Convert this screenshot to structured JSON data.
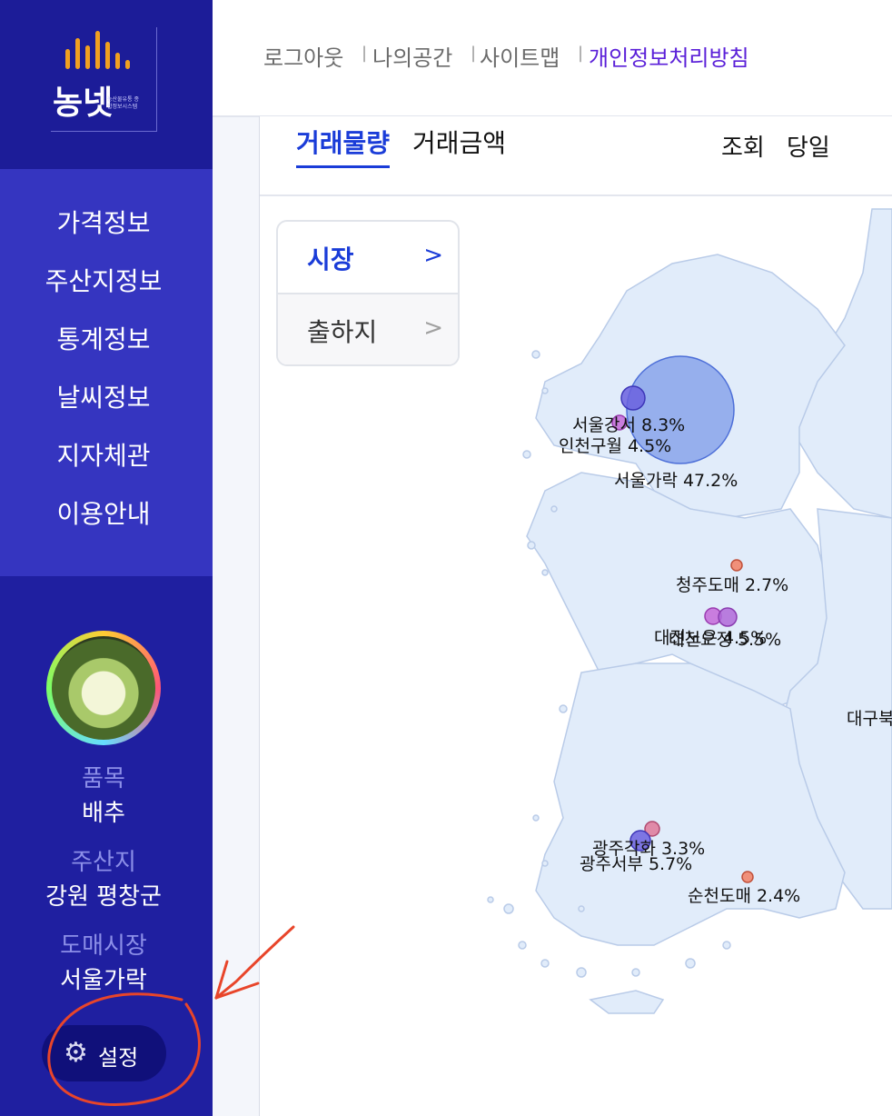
{
  "header": {
    "links": [
      "로그아웃",
      "나의공간",
      "사이트맵",
      "개인정보처리방침"
    ],
    "separator": "|"
  },
  "logo": {
    "brand": "농넷",
    "subtitle": "농산물유통 종합정보시스템"
  },
  "sidebar": {
    "nav": [
      "가격정보",
      "주산지정보",
      "통계정보",
      "날씨정보",
      "지자체관",
      "이용안내"
    ],
    "item_label": "품목",
    "item_value": "배추",
    "origin_label": "주산지",
    "origin_value": "강원 평창군",
    "market_label": "도매시장",
    "market_value": "서울가락",
    "settings_label": "설정",
    "settings_icon": "gear-icon"
  },
  "tabs": {
    "volume": "거래물량",
    "amount": "거래금액"
  },
  "query": {
    "label": "조회",
    "period": "당일"
  },
  "filter": {
    "market": "시장",
    "shipping": "출하지"
  },
  "map": {
    "markets": [
      {
        "name": "서울강서",
        "share": "8.3%",
        "label": "서울강서 8.3%"
      },
      {
        "name": "인천구월",
        "share": "4.5%",
        "label": "인천구월 4.5%"
      },
      {
        "name": "서울가락",
        "share": "47.2%",
        "label": "서울가락 47.2%"
      },
      {
        "name": "청주도매",
        "share": "2.7%",
        "label": "청주도매 2.7%"
      },
      {
        "name": "대전노은",
        "share": "4.5%",
        "label": "대전노은 4.5%"
      },
      {
        "name": "대전오정",
        "share": "5.5%",
        "label": "대전오정 5.5%"
      },
      {
        "name": "대구북부",
        "share": "",
        "label": "대구북"
      },
      {
        "name": "광주각화",
        "share": "3.3%",
        "label": "광주각화 3.3%"
      },
      {
        "name": "광주서부",
        "share": "5.7%",
        "label": "광주서부 5.7%"
      },
      {
        "name": "순천도매",
        "share": "2.4%",
        "label": "순천도매 2.4%"
      }
    ]
  },
  "colors": {
    "sidebar": "#1f1fa0",
    "nav": "#3535c0",
    "accent": "#1a3cd8",
    "privacy": "#5a1fd8",
    "annotation": "#e8452a"
  }
}
